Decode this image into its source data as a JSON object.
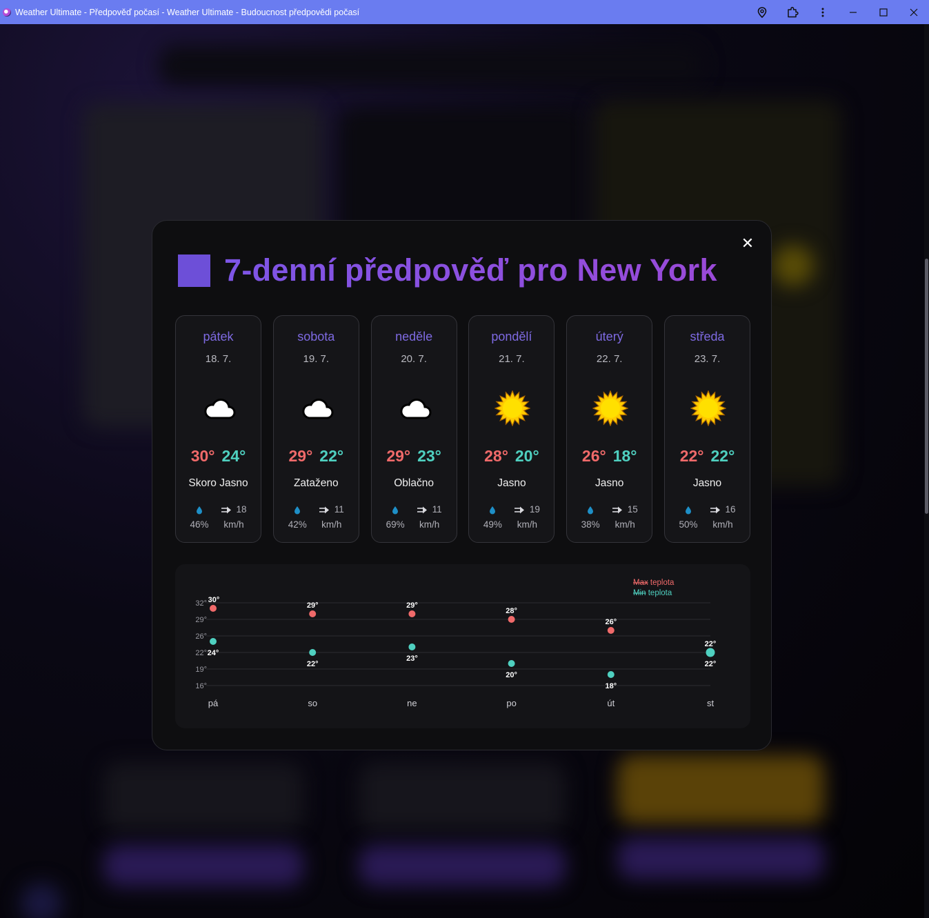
{
  "window": {
    "title": "Weather Ultimate - Předpověď počasí - Weather Ultimate - Budoucnost předpovědi počasí"
  },
  "modal": {
    "title": "7-denní předpověď pro New York",
    "close_label": "✕"
  },
  "colors": {
    "accent": "#7d55e6",
    "max_temp": "#f06a6a",
    "min_temp": "#4fd0c0",
    "titlebar": "#6a7cf0"
  },
  "days": [
    {
      "name": "pátek",
      "date": "18. 7.",
      "icon": "cloud-icon",
      "max": "30°",
      "min": "24°",
      "condition": "Skoro Jasno",
      "humidity": "46%",
      "wind": "18",
      "wind_unit": "km/h"
    },
    {
      "name": "sobota",
      "date": "19. 7.",
      "icon": "cloud-icon",
      "max": "29°",
      "min": "22°",
      "condition": "Zataženo",
      "humidity": "42%",
      "wind": "11",
      "wind_unit": "km/h"
    },
    {
      "name": "neděle",
      "date": "20. 7.",
      "icon": "cloud-icon",
      "max": "29°",
      "min": "23°",
      "condition": "Oblačno",
      "humidity": "69%",
      "wind": "11",
      "wind_unit": "km/h"
    },
    {
      "name": "pondělí",
      "date": "21. 7.",
      "icon": "sun-icon",
      "max": "28°",
      "min": "20°",
      "condition": "Jasno",
      "humidity": "49%",
      "wind": "19",
      "wind_unit": "km/h"
    },
    {
      "name": "úterý",
      "date": "22. 7.",
      "icon": "sun-icon",
      "max": "26°",
      "min": "18°",
      "condition": "Jasno",
      "humidity": "38%",
      "wind": "15",
      "wind_unit": "km/h"
    },
    {
      "name": "středa",
      "date": "23. 7.",
      "icon": "sun-icon",
      "max": "22°",
      "min": "22°",
      "condition": "Jasno",
      "humidity": "50%",
      "wind": "16",
      "wind_unit": "km/h"
    }
  ],
  "chart_data": {
    "type": "scatter",
    "categories": [
      "pá",
      "so",
      "ne",
      "po",
      "út",
      "st"
    ],
    "series": [
      {
        "name": "Max teplota",
        "values": [
          30,
          29,
          29,
          28,
          26,
          22
        ],
        "color": "#f06a6a"
      },
      {
        "name": "Min teplota",
        "values": [
          24,
          22,
          23,
          20,
          18,
          22
        ],
        "color": "#4fd0c0"
      }
    ],
    "data_labels": {
      "max": [
        "30°",
        "29°",
        "29°",
        "28°",
        "26°",
        "22°"
      ],
      "min": [
        "24°",
        "22°",
        "23°",
        "20°",
        "18°",
        "22°"
      ]
    },
    "yticks": [
      "16°",
      "19°",
      "22°",
      "26°",
      "29°",
      "32°"
    ],
    "ytick_values": [
      16,
      19,
      22,
      25,
      28,
      31
    ],
    "legend_position": "top-right",
    "legend": [
      {
        "strike": "Max",
        "label": "teplota"
      },
      {
        "strike": "Min",
        "label": "teplota"
      }
    ],
    "grid": true
  }
}
